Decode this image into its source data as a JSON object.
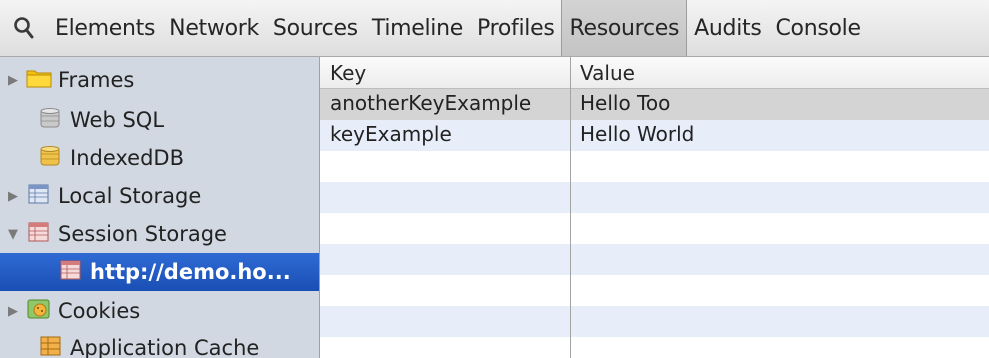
{
  "toolbar": {
    "tabs": [
      {
        "label": "Elements"
      },
      {
        "label": "Network"
      },
      {
        "label": "Sources"
      },
      {
        "label": "Timeline"
      },
      {
        "label": "Profiles"
      },
      {
        "label": "Resources",
        "active": true
      },
      {
        "label": "Audits"
      },
      {
        "label": "Console"
      }
    ],
    "search_icon": "magnifier-icon"
  },
  "sidebar": {
    "items": [
      {
        "label": "Frames",
        "icon": "folder-icon",
        "disclosure": "▶"
      },
      {
        "label": "Web SQL",
        "icon": "database-icon"
      },
      {
        "label": "IndexedDB",
        "icon": "database-icon"
      },
      {
        "label": "Local Storage",
        "icon": "storage-table-icon",
        "disclosure": "▶"
      },
      {
        "label": "Session Storage",
        "icon": "storage-table-icon",
        "disclosure": "▼"
      },
      {
        "label": "http://demo.ho...",
        "icon": "storage-table-icon",
        "selected": true
      },
      {
        "label": "Cookies",
        "icon": "cookie-icon",
        "disclosure": "▶"
      },
      {
        "label": "Application Cache",
        "icon": "app-cache-icon"
      }
    ]
  },
  "grid": {
    "columns": [
      "Key",
      "Value"
    ],
    "rows": [
      {
        "key": "anotherKeyExample",
        "value": "Hello Too"
      },
      {
        "key": "keyExample",
        "value": "Hello World"
      }
    ]
  },
  "colors": {
    "selected_item": "#1f55bb",
    "sidebar_bg": "#d1d8e1",
    "row_stripe": "#e7eefa",
    "row_highlight": "#d4d4d4"
  }
}
